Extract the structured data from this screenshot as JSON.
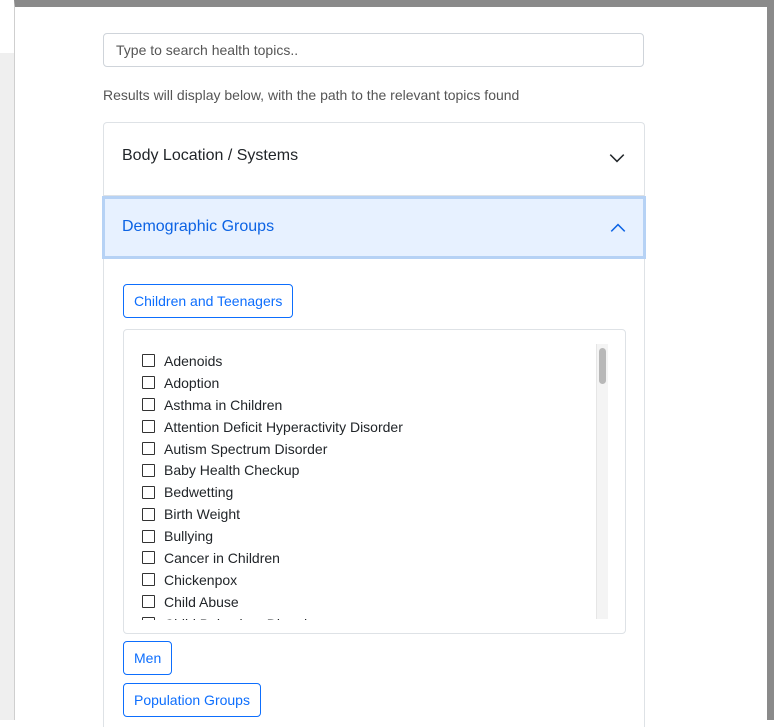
{
  "search": {
    "placeholder": "Type to search health topics..",
    "value": ""
  },
  "hint": "Results will display below, with the path to the relevant topics found",
  "accordion": {
    "items": [
      {
        "label": "Body Location / Systems",
        "expanded": false,
        "icon": "chevron-down-icon"
      },
      {
        "label": "Demographic Groups",
        "expanded": true,
        "icon": "chevron-up-icon"
      }
    ]
  },
  "groups": {
    "children_label": "Children and Teenagers",
    "men_label": "Men",
    "population_label": "Population Groups"
  },
  "topics": [
    "Adenoids",
    "Adoption",
    "Asthma in Children",
    "Attention Deficit Hyperactivity Disorder",
    "Autism Spectrum Disorder",
    "Baby Health Checkup",
    "Bedwetting",
    "Birth Weight",
    "Bullying",
    "Cancer in Children",
    "Chickenpox",
    "Child Abuse",
    "Child Behaviour Disorders"
  ],
  "colors": {
    "accent": "#0d6efd",
    "expanded_bg": "#e7f1ff",
    "expanded_text": "#0c63e4"
  }
}
